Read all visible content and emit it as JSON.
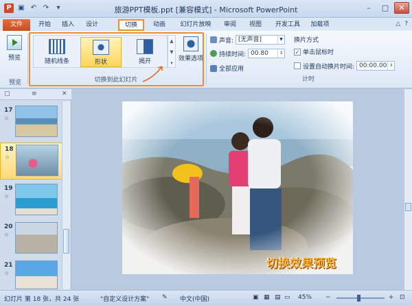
{
  "window": {
    "title": "旅游PPT模板.ppt [兼容模式] - Microsoft PowerPoint",
    "app_badge": "P",
    "qat": [
      "save-icon",
      "undo-icon",
      "redo-icon",
      "customize-icon"
    ],
    "controls": [
      "–",
      "□",
      "✕"
    ]
  },
  "tabs": {
    "file": "文件",
    "items": [
      "开始",
      "插入",
      "设计",
      "切换",
      "动画",
      "幻灯片放映",
      "审阅",
      "视图",
      "开发工具",
      "加载项"
    ],
    "active": "切换"
  },
  "ribbon": {
    "preview": {
      "label": "预览",
      "group": "预览"
    },
    "transitions": {
      "items": [
        {
          "label": "随机线条",
          "icon": "random-bars-icon"
        },
        {
          "label": "形状",
          "icon": "shape-icon",
          "selected": true
        },
        {
          "label": "揭开",
          "icon": "uncover-icon"
        }
      ],
      "effects_label": "效果选项",
      "group": "切换到此幻灯片"
    },
    "timing": {
      "sound_label": "声音:",
      "sound_value": "[无声音]",
      "duration_label": "持续时间:",
      "duration_value": "00.80",
      "apply_all": "全部应用",
      "advance_title": "换片方式",
      "on_click": "单击鼠标时",
      "on_click_checked": true,
      "after_label": "设置自动换片时间:",
      "after_value": "00:00.00",
      "after_checked": false,
      "group": "计时"
    }
  },
  "slides": [
    {
      "num": "17",
      "star": "☆"
    },
    {
      "num": "18",
      "star": "☆",
      "selected": true
    },
    {
      "num": "19",
      "star": "☆"
    },
    {
      "num": "20",
      "star": "☆"
    },
    {
      "num": "21",
      "star": "☆"
    }
  ],
  "slide": {
    "caption": "切换效果预览"
  },
  "status": {
    "slide_info": "幻灯片 第 18 张，共 24 张",
    "theme": "\"自定义设计方案\"",
    "language": "中文(中国)",
    "zoom": "45%"
  },
  "colors": {
    "file_tab": "#d0592a",
    "highlight": "#f08c2e",
    "selection": "#ffd45c"
  }
}
